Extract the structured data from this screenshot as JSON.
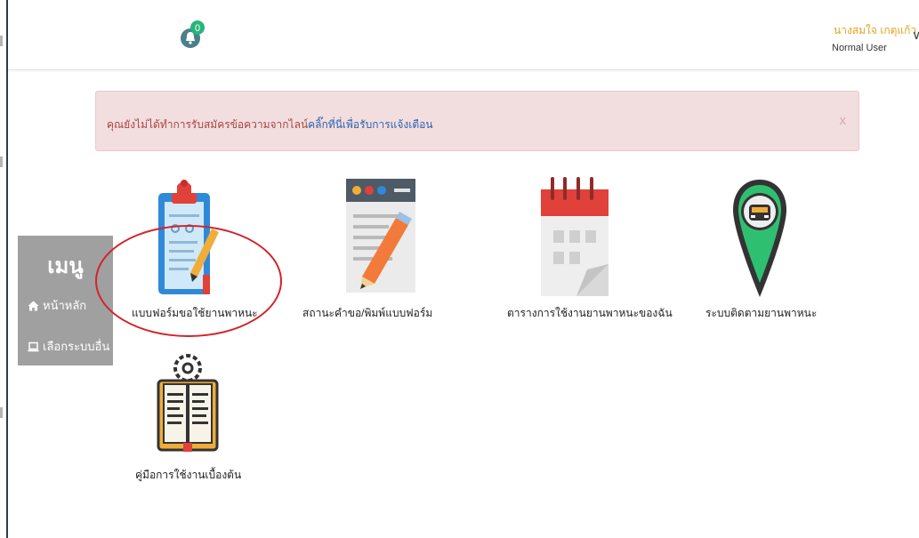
{
  "header": {
    "notification_count": "0",
    "user_name": "นางสมใจ เกตุแก้ว",
    "user_role": "Normal User",
    "dropdown_glyph": "∨"
  },
  "alert": {
    "message": "คุณยังไม่ได้ทำการรับสมัครข้อความจากไลน์",
    "link_text": "คลิ๊กที่นี่เพื่อรับการแจ้งเตือน",
    "close_label": "x"
  },
  "menu": {
    "title": "เมนู",
    "items": [
      {
        "icon": "home-icon",
        "label": "หน้าหลัก"
      },
      {
        "icon": "laptop-icon",
        "label": "เลือกระบบอื่น"
      }
    ]
  },
  "apps": [
    {
      "icon": "clipboard-form-icon",
      "label": "แบบฟอร์มขอใช้ยานพาหนะ"
    },
    {
      "icon": "document-pencil-icon",
      "label": "สถานะคำขอ/พิมพ์แบบฟอร์ม"
    },
    {
      "icon": "calendar-icon",
      "label": "ตารางการใช้งานยานพาหนะของฉัน"
    },
    {
      "icon": "car-location-pin-icon",
      "label": "ระบบติดตามยานพาหนะ"
    },
    {
      "icon": "manual-book-gear-icon",
      "label": "คู่มือการใช้งานเบื้องต้น"
    }
  ],
  "colors": {
    "alert_bg": "#f2dede",
    "alert_text": "#a94442",
    "link": "#2b62b0",
    "user_name": "#e1a41f",
    "menu_bg": "#a0a0a0",
    "highlight": "#d2232a"
  }
}
